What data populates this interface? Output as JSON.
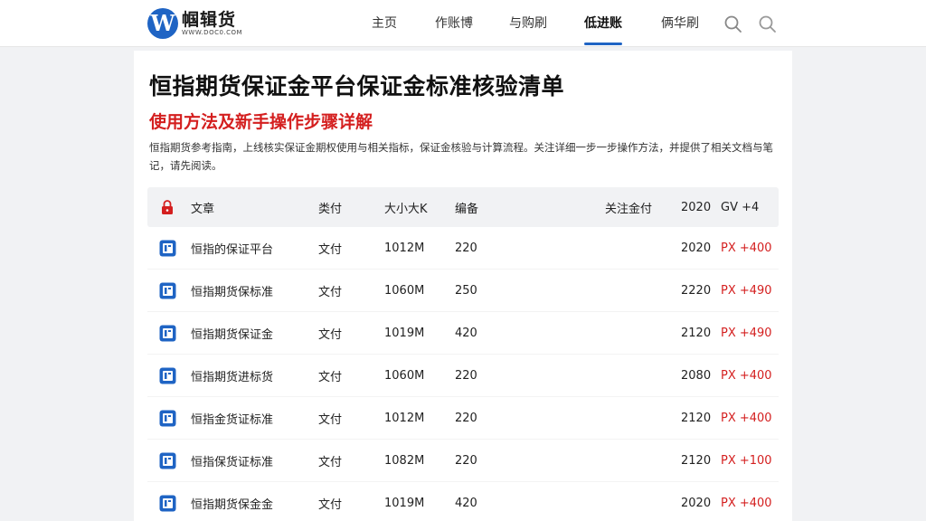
{
  "header": {
    "logo_letter": "W",
    "logo_name": "帼辑货",
    "logo_sub": "WWW.DOC0.COM",
    "nav": [
      {
        "label": "主页",
        "active": false
      },
      {
        "label": "作账博",
        "active": false
      },
      {
        "label": "与购刷",
        "active": false
      },
      {
        "label": "低进账",
        "active": true
      },
      {
        "label": "俩华刷",
        "active": false
      }
    ]
  },
  "article": {
    "title": "恒指期货保证金平台保证金标准核验清单",
    "subtitle": "使用方法及新手操作步骤详解",
    "description": "恒指期货参考指南，上线核实保证金期权使用与相关指标，保证金核验与计算流程。关注详细一步一步操作方法，并提供了相关文档与笔记，请先阅读。"
  },
  "table": {
    "columns": [
      "文章",
      "类付",
      "大小大K",
      "编备",
      "关注金付",
      "2020",
      "GV +4"
    ],
    "rows": [
      {
        "name": "恒指的保证平台",
        "type": "文付",
        "size": "1012M",
        "count": "220",
        "year": "2020",
        "change": "PX +400"
      },
      {
        "name": "恒指期货保标准",
        "type": "文付",
        "size": "1060M",
        "count": "250",
        "year": "2220",
        "change": "PX +490"
      },
      {
        "name": "恒指期货保证金",
        "type": "文付",
        "size": "1019M",
        "count": "420",
        "year": "2120",
        "change": "PX +490"
      },
      {
        "name": "恒指期货进标货",
        "type": "文付",
        "size": "1060M",
        "count": "220",
        "year": "2080",
        "change": "PX +400"
      },
      {
        "name": "恒指金货证标准",
        "type": "文付",
        "size": "1012M",
        "count": "220",
        "year": "2120",
        "change": "PX +400"
      },
      {
        "name": "恒指保货证标准",
        "type": "文付",
        "size": "1082M",
        "count": "220",
        "year": "2120",
        "change": "PX +100"
      },
      {
        "name": "恒指期货保金金",
        "type": "文付",
        "size": "1019M",
        "count": "420",
        "year": "2020",
        "change": "PX +400"
      }
    ]
  },
  "colors": {
    "accent": "#1f64c4",
    "red": "#d41f1f",
    "header_bg": "#f1f2f4"
  },
  "icons": {
    "search": "search-icon",
    "lock": "lock-icon",
    "doc": "document-icon"
  }
}
